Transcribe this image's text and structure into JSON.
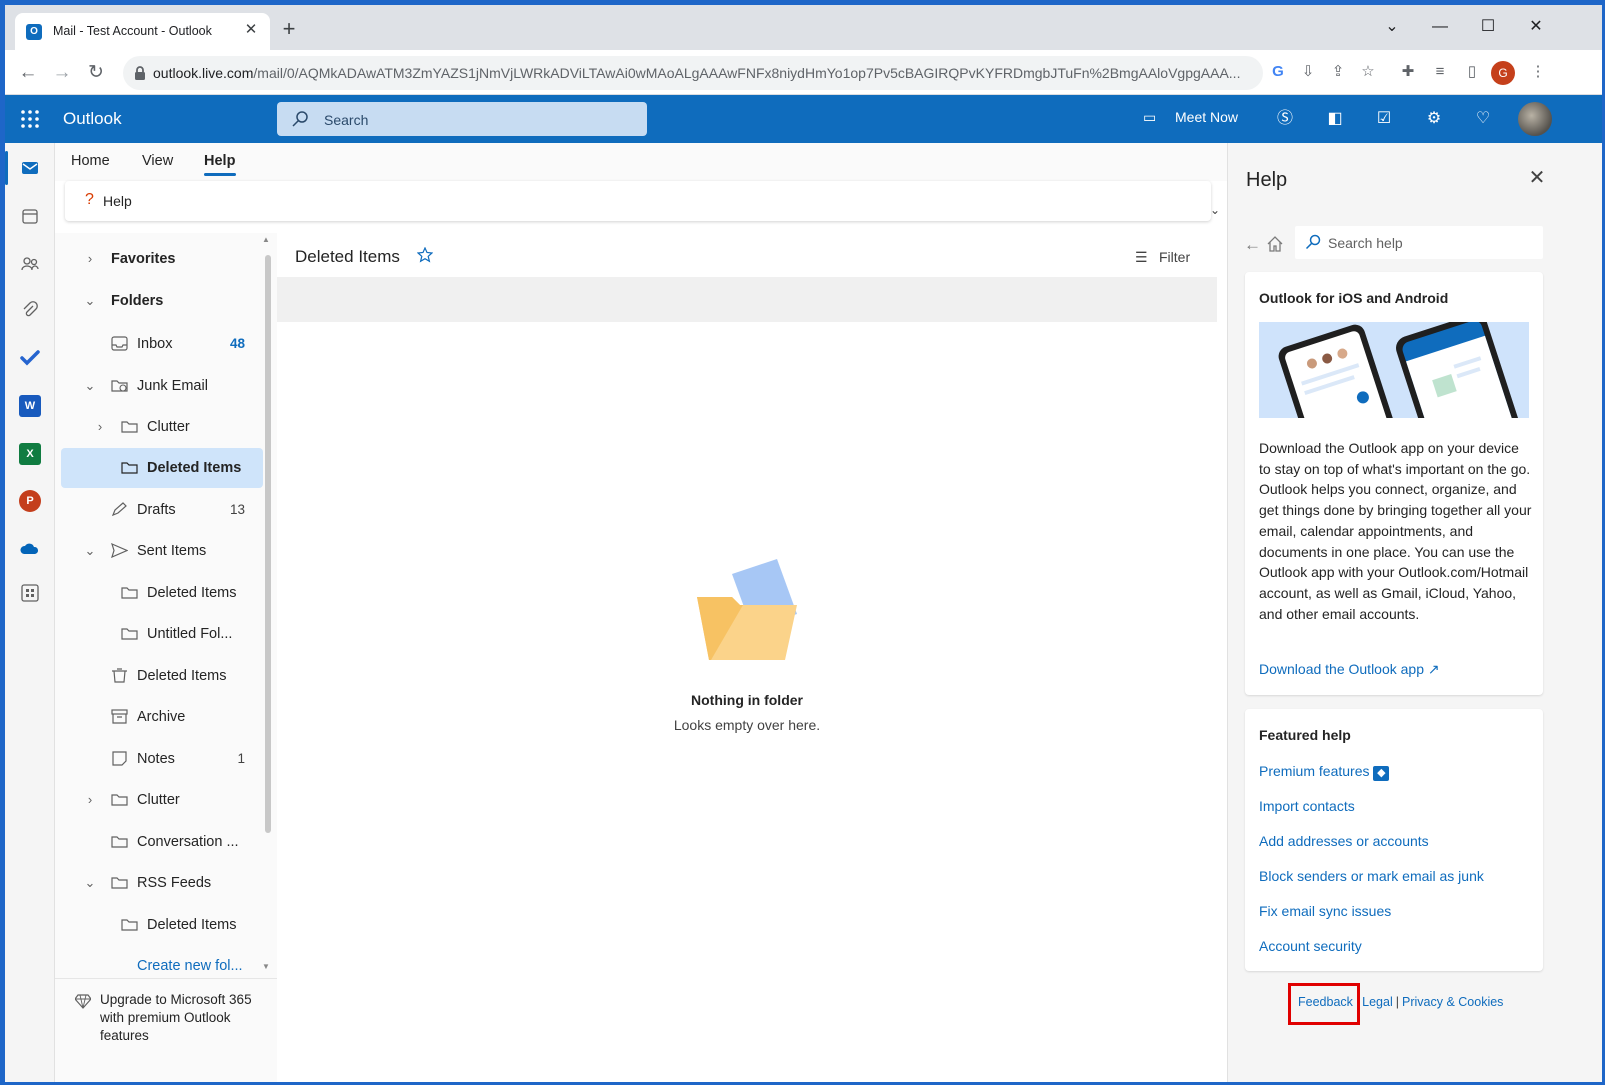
{
  "browser": {
    "tab_title": "Mail - Test Account - Outlook",
    "tab_favicon": "O",
    "url_host": "outlook.live.com",
    "url_path": "/mail/0/AQMkADAwATM3ZmYAZS1jNmVjLWRkADViLTAwAi0wMAoALgAAAwFNFx8niydHmYo1op7Pv5cBAGIRQPvKYFRDmgbJTuFn%2BmgAAloVgpgAAA...",
    "profile_initial": "G",
    "window_controls": [
      "chevron-down-icon",
      "minimize-icon",
      "maximize-icon",
      "close-icon"
    ]
  },
  "header": {
    "brand": "Outlook",
    "search_placeholder": "Search",
    "meet_now": "Meet Now"
  },
  "ribbon": {
    "tabs": [
      "Home",
      "View",
      "Help"
    ],
    "active_tab": "Help",
    "help_button": "Help"
  },
  "folders": {
    "favorites": "Favorites",
    "folders": "Folders",
    "items": [
      {
        "label": "Inbox",
        "count": "48"
      },
      {
        "label": "Junk Email",
        "count": ""
      },
      {
        "label": "Clutter",
        "count": ""
      },
      {
        "label": "Deleted Items",
        "count": ""
      },
      {
        "label": "Drafts",
        "count": "13"
      },
      {
        "label": "Sent Items",
        "count": ""
      },
      {
        "label": "Deleted Items",
        "count": ""
      },
      {
        "label": "Untitled Fol...",
        "count": ""
      },
      {
        "label": "Deleted Items",
        "count": ""
      },
      {
        "label": "Archive",
        "count": ""
      },
      {
        "label": "Notes",
        "count": "1"
      },
      {
        "label": "Clutter",
        "count": ""
      },
      {
        "label": "Conversation ...",
        "count": ""
      },
      {
        "label": "RSS Feeds",
        "count": ""
      },
      {
        "label": "Deleted Items",
        "count": ""
      }
    ],
    "create_new": "Create new fol...",
    "upgrade": "Upgrade to Microsoft 365 with premium Outlook features"
  },
  "message_list": {
    "title": "Deleted Items",
    "filter": "Filter",
    "empty_title": "Nothing in folder",
    "empty_subtitle": "Looks empty over here."
  },
  "help": {
    "title": "Help",
    "search_placeholder": "Search help",
    "card_title": "Outlook for iOS and Android",
    "card_body": "Download the Outlook app on your device to stay on top of what's important on the go. Outlook helps you connect, organize, and get things done by bringing together all your email, calendar appointments, and documents in one place. You can use the Outlook app with your Outlook.com/Hotmail account, as well as Gmail, iCloud, Yahoo, and other email accounts.",
    "download_link": "Download the Outlook app",
    "featured_title": "Featured help",
    "featured_links": [
      "Premium features",
      "Import contacts",
      "Add addresses or accounts",
      "Block senders or mark email as junk",
      "Fix email sync issues",
      "Account security"
    ],
    "footer": {
      "feedback": "Feedback",
      "legal": "Legal",
      "privacy": "Privacy & Cookies",
      "separator": "|"
    }
  },
  "colors": {
    "accent": "#0f6cbd",
    "selected_folder": "#cfe4fa",
    "highlight_box": "#e00000"
  }
}
